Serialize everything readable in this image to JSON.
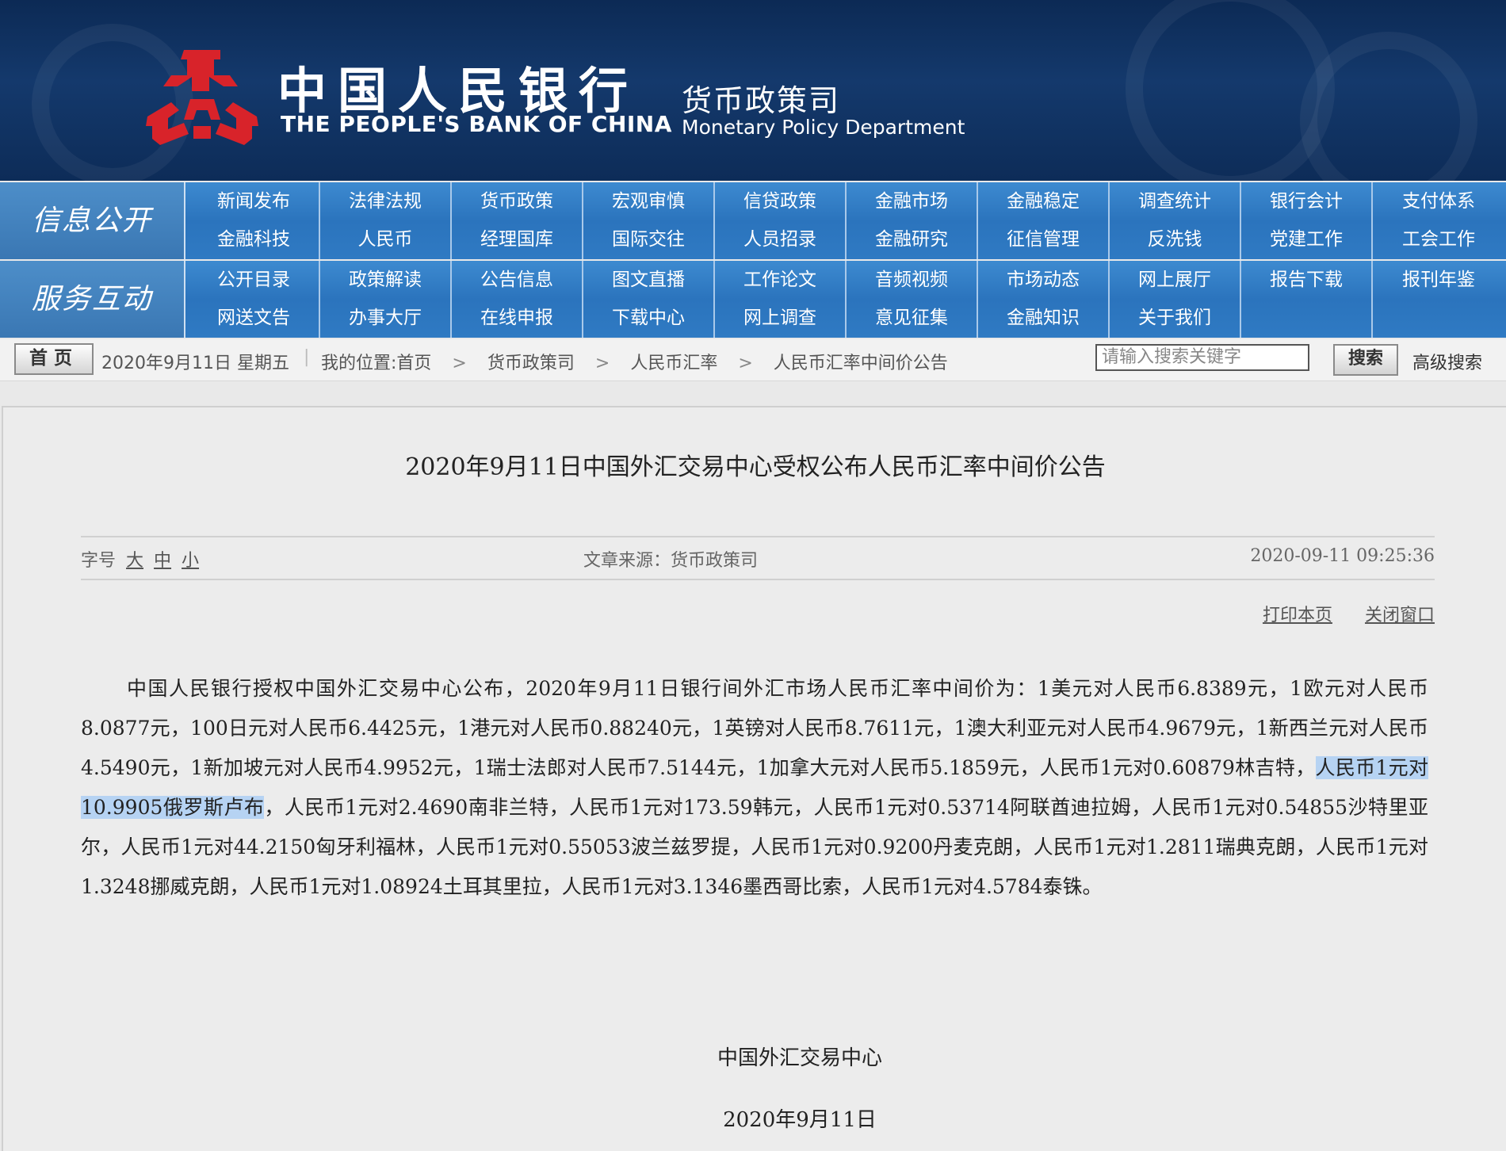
{
  "header": {
    "title_cn": "中国人民银行",
    "title_en": "THE PEOPLE'S BANK OF CHINA",
    "dept_cn": "货币政策司",
    "dept_en": "Monetary Policy Department"
  },
  "nav1": {
    "section": "信息公开",
    "items": [
      "新闻发布",
      "法律法规",
      "货币政策",
      "宏观审慎",
      "信贷政策",
      "金融市场",
      "金融稳定",
      "调查统计",
      "银行会计",
      "支付体系",
      "金融科技",
      "人民币",
      "经理国库",
      "国际交往",
      "人员招录",
      "金融研究",
      "征信管理",
      "反洗钱",
      "党建工作",
      "工会工作"
    ]
  },
  "nav2": {
    "section": "服务互动",
    "items": [
      "公开目录",
      "政策解读",
      "公告信息",
      "图文直播",
      "工作论文",
      "音频视频",
      "市场动态",
      "网上展厅",
      "报告下载",
      "报刊年鉴",
      "网送文告",
      "办事大厅",
      "在线申报",
      "下载中心",
      "网上调查",
      "意见征集",
      "金融知识",
      "关于我们",
      "",
      ""
    ]
  },
  "crumb": {
    "home": "首页",
    "date": "2020年9月11日  星期五",
    "sep": "|",
    "location_label": "我的位置:首页",
    "path": [
      "货币政策司",
      "人民币汇率",
      "人民币汇率中间价公告"
    ],
    "search_placeholder": "请输入搜索关键字",
    "search_button": "搜索",
    "advanced": "高级搜索"
  },
  "article": {
    "title": "2020年9月11日中国外汇交易中心受权公布人民币汇率中间价公告",
    "font_label": "字号",
    "font_sizes": [
      "大",
      "中",
      "小"
    ],
    "source": "文章来源：货币政策司",
    "time": "2020-09-11 09:25:36",
    "print": "打印本页",
    "close": "关闭窗口",
    "body_pre": "中国人民银行授权中国外汇交易中心公布，2020年9月11日银行间外汇市场人民币汇率中间价为：1美元对人民币6.8389元，1欧元对人民币8.0877元，100日元对人民币6.4425元，1港元对人民币0.88240元，1英镑对人民币8.7611元，1澳大利亚元对人民币4.9679元，1新西兰元对人民币4.5490元，1新加坡元对人民币4.9952元，1瑞士法郎对人民币7.5144元，1加拿大元对人民币5.1859元，人民币1元对0.60879林吉特，",
    "body_highlight": "人民币1元对10.9905俄罗斯卢布",
    "body_post": "，人民币1元对2.4690南非兰特，人民币1元对173.59韩元，人民币1元对0.53714阿联酋迪拉姆，人民币1元对0.54855沙特里亚尔，人民币1元对44.2150匈牙利福林，人民币1元对0.55053波兰兹罗提，人民币1元对0.9200丹麦克朗，人民币1元对1.2811瑞典克朗，人民币1元对1.3248挪威克朗，人民币1元对1.08924土耳其里拉，人民币1元对3.1346墨西哥比索，人民币1元对4.5784泰铢。",
    "sign_org": "中国外汇交易中心",
    "sign_date": "2020年9月11日"
  },
  "colors": {
    "banner": "#14396c",
    "nav": "#2f7ac3",
    "emblem": "#d8232a",
    "highlight": "#b6d3f3"
  },
  "icons": {
    "logo": "pboc-emblem-icon"
  }
}
